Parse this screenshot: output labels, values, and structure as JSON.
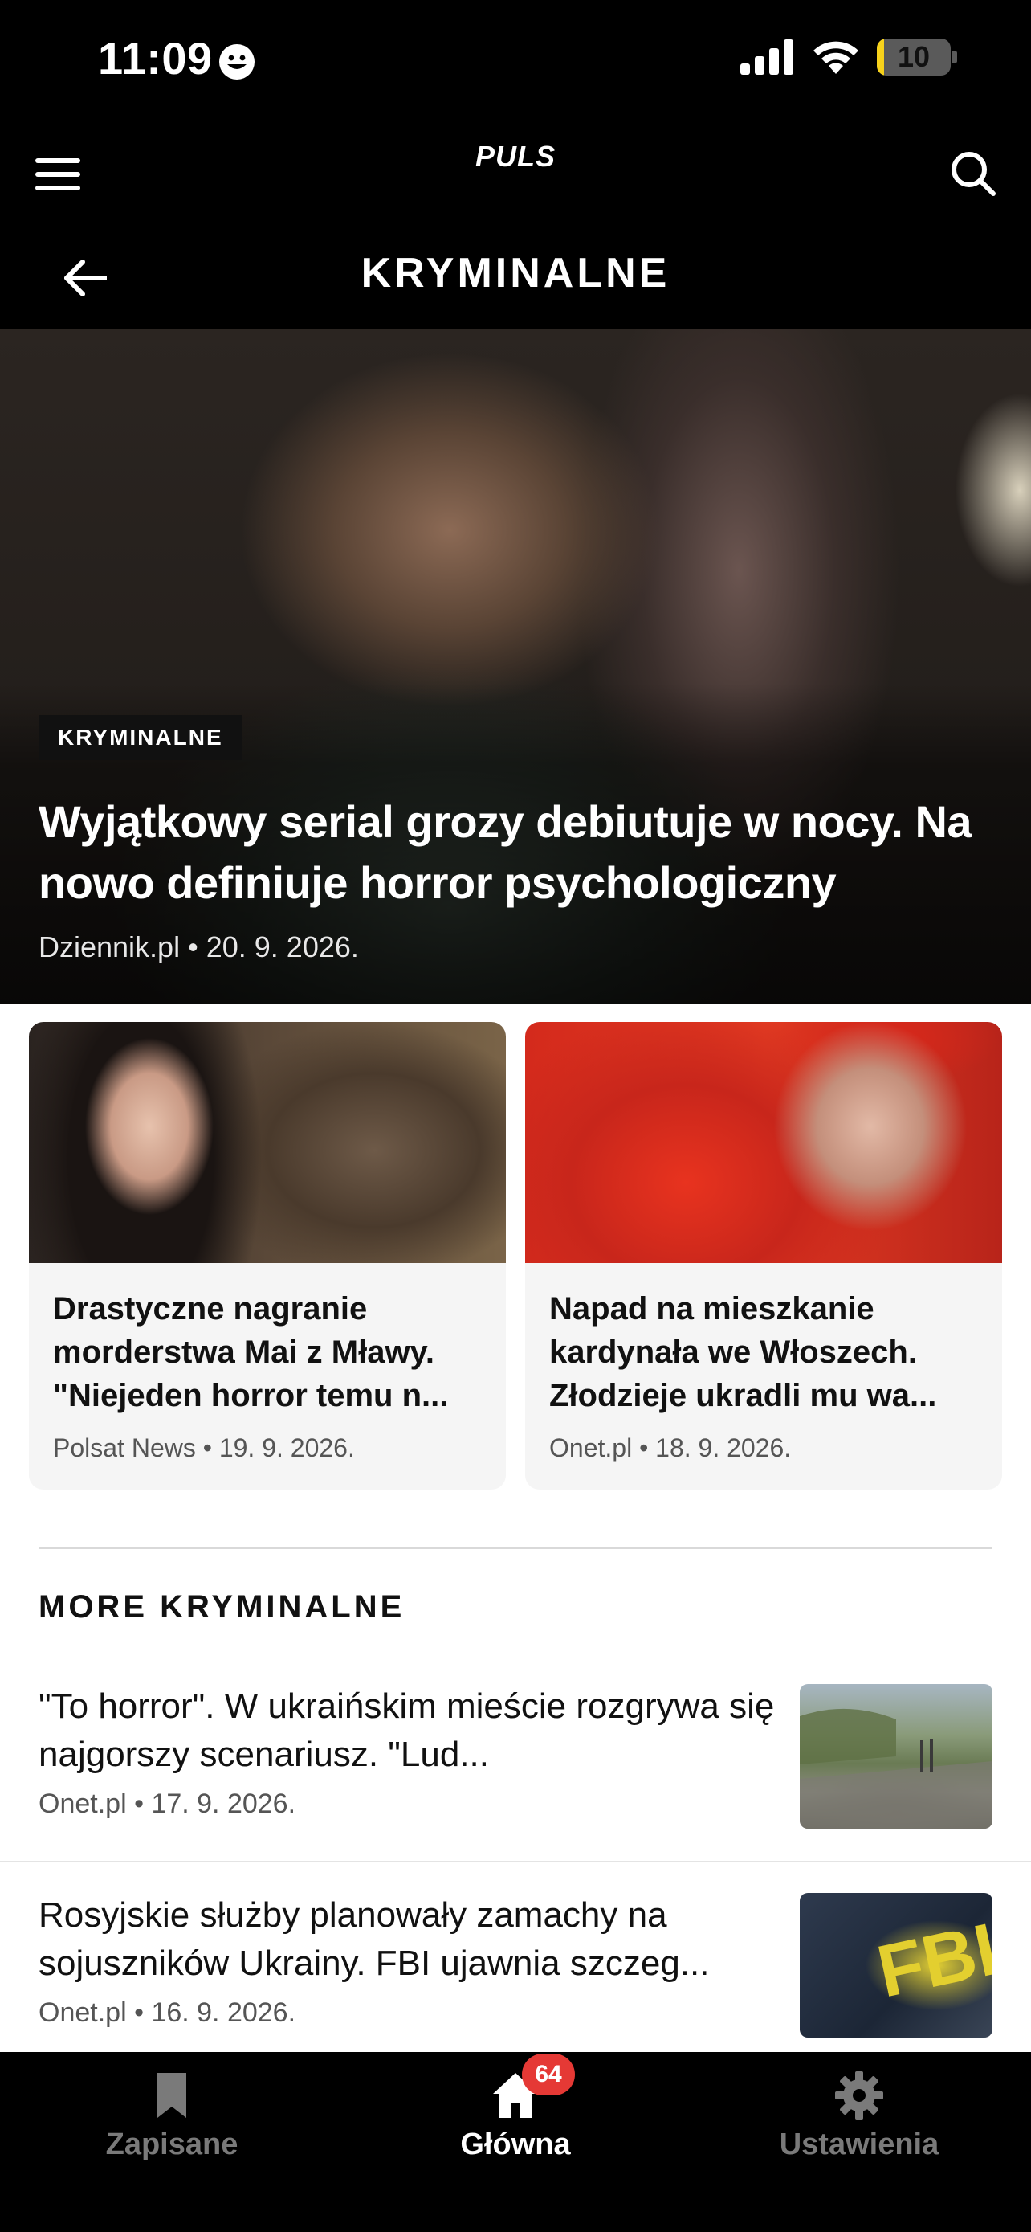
{
  "status_bar": {
    "time": "11:09",
    "battery_level": "10",
    "battery_fraction": 0.1
  },
  "app": {
    "logo": "PULS",
    "page_title": "KRYMINALNE"
  },
  "hero": {
    "category": "KRYMINALNE",
    "title": "Wyjątkowy serial grozy debiutuje w nocy. Na nowo definiuje horror psychologiczny",
    "source": "Dziennik.pl",
    "date": "20. 9. 2026."
  },
  "cards": [
    {
      "title": "Drastyczne nagranie morderstwa Mai z Mławy. \"Niejeden horror temu n...",
      "source": "Polsat News",
      "date": "19. 9. 2026."
    },
    {
      "title": "Napad na mieszkanie kardynała we Włoszech. Złodzieje ukradli mu wa...",
      "source": "Onet.pl",
      "date": "18. 9. 2026."
    }
  ],
  "section": {
    "title": "MORE KRYMINALNE"
  },
  "list": [
    {
      "title": "\"To horror\". W ukraińskim mieście rozgrywa się najgorszy scenariusz. \"Lud...",
      "source": "Onet.pl",
      "date": "17. 9. 2026."
    },
    {
      "title": "Rosyjskie służby planowały zamachy na sojuszników Ukrainy. FBI ujawnia szczeg...",
      "source": "Onet.pl",
      "date": "16. 9. 2026.",
      "thumb_text": "FBI"
    }
  ],
  "tabs": {
    "saved": "Zapisane",
    "home": "Główna",
    "home_badge": "64",
    "settings": "Ustawienia"
  },
  "colors": {
    "background": "#000000",
    "badge": "#e53935",
    "battery": "#f7d21b"
  }
}
